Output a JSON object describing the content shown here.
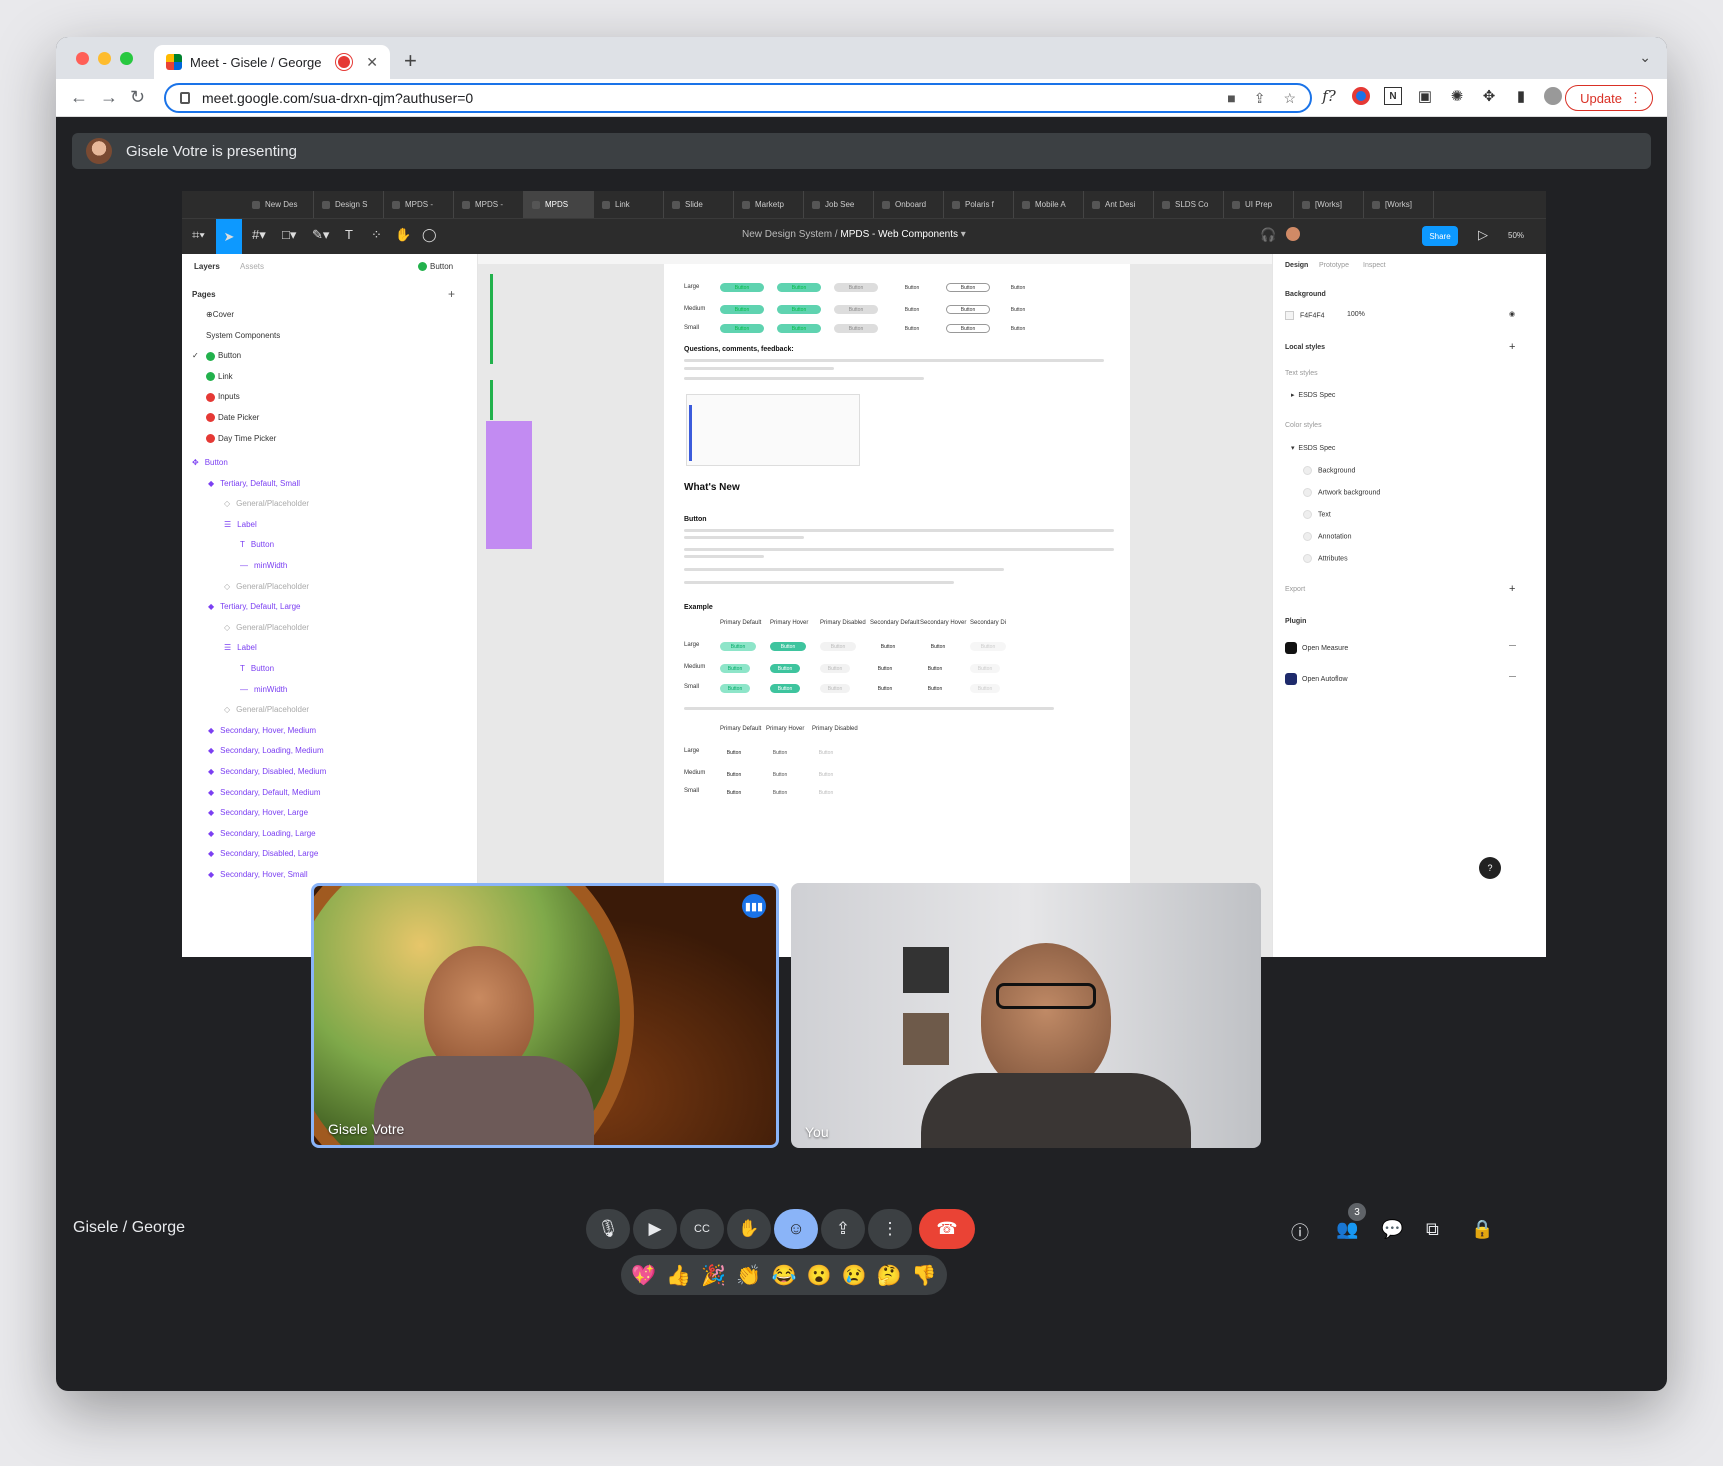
{
  "browser": {
    "tab_title": "Meet - Gisele / George",
    "url": "meet.google.com/sua-drxn-qjm?authuser=0",
    "update_label": "Update",
    "ext_label": "f?"
  },
  "meet": {
    "presenting_text": "Gisele Votre is presenting",
    "meeting_name": "Gisele / George",
    "participant_count": "3",
    "tiles": [
      {
        "name": "Gisele Votre"
      },
      {
        "name": "You"
      }
    ],
    "reactions": [
      "💖",
      "👍",
      "🎉",
      "👏",
      "😂",
      "😮",
      "😢",
      "🤔",
      "👎"
    ]
  },
  "figma": {
    "tabs": [
      "New Des",
      "Design S",
      "MPDS -",
      "MPDS -",
      "MPDS",
      "Link",
      "Slide",
      "Marketp",
      "Job See",
      "Onboard",
      "Polaris f",
      "Mobile A",
      "Ant Desi",
      "SLDS Co",
      "UI Prep",
      "[Works]",
      "[Works]"
    ],
    "breadcrumb_team": "New Design System",
    "breadcrumb_file": "MPDS - Web Components",
    "share_label": "Share",
    "zoom": "50%",
    "left_tabs": {
      "layers": "Layers",
      "assets": "Assets",
      "page_selector": "Button"
    },
    "pages_label": "Pages",
    "pages": [
      "⊕Cover",
      "System Components",
      "Button",
      "Link",
      "Inputs",
      "Date Picker",
      "Day Time Picker"
    ],
    "layers": [
      "Button",
      "Tertiary, Default, Small",
      "General/Placeholder",
      "Label",
      "Button",
      "minWidth",
      "General/Placeholder",
      "Tertiary, Default, Large",
      "General/Placeholder",
      "Label",
      "Button",
      "minWidth",
      "General/Placeholder",
      "Secondary, Hover, Medium",
      "Secondary, Loading, Medium",
      "Secondary, Disabled, Medium",
      "Secondary, Default, Medium",
      "Secondary, Hover, Large",
      "Secondary, Loading, Large",
      "Secondary, Disabled, Large",
      "Secondary, Hover, Small"
    ],
    "doc": {
      "sizes": [
        "Large",
        "Medium",
        "Small"
      ],
      "button": "Button",
      "questions_heading": "Questions, comments, feedback:",
      "whats_new": "What's New",
      "button_heading": "Button",
      "example_heading": "Example",
      "example_cols": [
        "Primary Default",
        "Primary Hover",
        "Primary Disabled",
        "Secondary Default",
        "Secondary Hover",
        "Secondary Di"
      ],
      "tertiary_cols": [
        "Primary Default",
        "Primary Hover",
        "Primary Disabled"
      ]
    },
    "right": {
      "tabs": [
        "Design",
        "Prototype",
        "Inspect"
      ],
      "background_label": "Background",
      "bg_hex": "F4F4F4",
      "bg_opacity": "100%",
      "local_styles": "Local styles",
      "text_styles": "Text styles",
      "esds_spec": "ESDS Spec",
      "color_styles": "Color styles",
      "color_items": [
        "Background",
        "Artwork background",
        "Text",
        "Annotation",
        "Attributes"
      ],
      "export": "Export",
      "plugin": "Plugin",
      "plugins": [
        "Open Measure",
        "Open Autoflow"
      ]
    }
  },
  "colors": {
    "accent": "#8ab4f8",
    "end_call": "#ea4335",
    "figma_green": "#5fd3b0",
    "figma_purple": "#7b3ff2"
  }
}
